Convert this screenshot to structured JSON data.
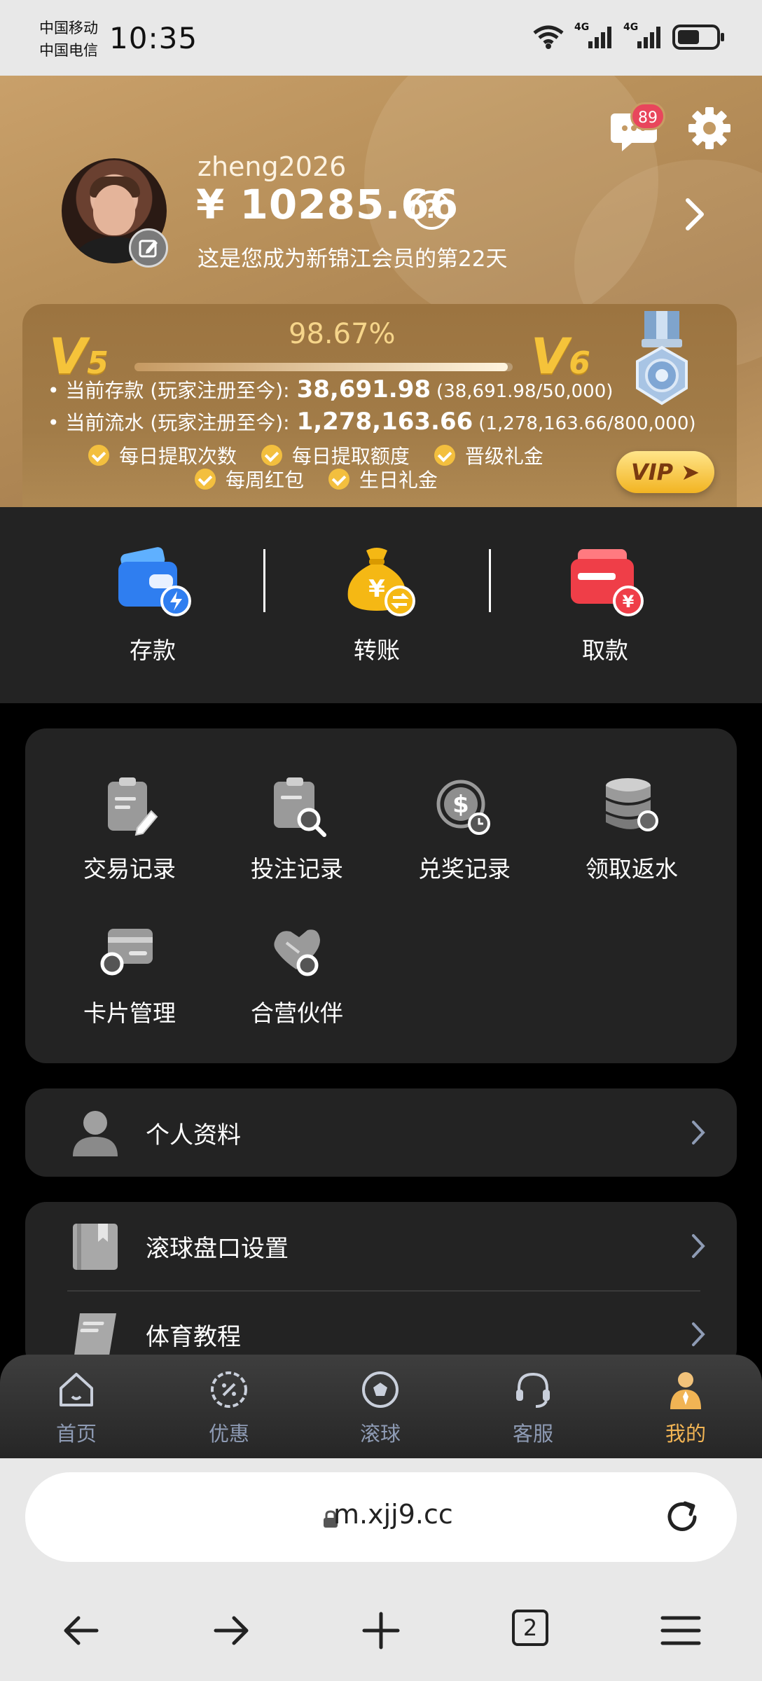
{
  "status_bar": {
    "carrier1": "中国移动",
    "carrier2": "中国电信",
    "time": "10:35",
    "net1": "4G",
    "net2": "4G"
  },
  "header": {
    "message_count": "89",
    "username": "zheng2026",
    "balance": "¥ 10285.66",
    "help": "?",
    "member_days": "这是您成为新锦江会员的第22天"
  },
  "vip": {
    "percent": "98.67%",
    "progress": 0.9867,
    "current_level": "V",
    "current_level_num": "5",
    "next_level": "V",
    "next_level_num": "6",
    "deposit_label": "• 当前存款 (玩家注册至今):",
    "deposit_value": "38,691.98",
    "deposit_paren": "(38,691.98/50,000)",
    "turnover_label": "• 当前流水 (玩家注册至今):",
    "turnover_value": "1,278,163.66",
    "turnover_paren": "(1,278,163.66/800,000)",
    "perks_row1": [
      "每日提取次数",
      "每日提取额度",
      "晋级礼金"
    ],
    "perks_row2": [
      "每周红包",
      "生日礼金"
    ],
    "vip_button": "VIP ➤"
  },
  "actions": [
    {
      "label": "存款",
      "icon": "wallet-icon"
    },
    {
      "label": "转账",
      "icon": "money-bag-icon"
    },
    {
      "label": "取款",
      "icon": "card-withdraw-icon"
    }
  ],
  "grid": [
    {
      "label": "交易记录",
      "icon": "clipboard-pen-icon"
    },
    {
      "label": "投注记录",
      "icon": "clipboard-search-icon"
    },
    {
      "label": "兑奖记录",
      "icon": "dollar-clock-icon"
    },
    {
      "label": "领取返水",
      "icon": "coin-stack-icon"
    },
    {
      "label": "卡片管理",
      "icon": "card-icon"
    },
    {
      "label": "合营伙伴",
      "icon": "handshake-icon"
    }
  ],
  "list1": [
    {
      "label": "个人资料",
      "icon": "person-icon"
    }
  ],
  "list2": [
    {
      "label": "滚球盘口设置",
      "icon": "bookmark-book-icon"
    },
    {
      "label": "体育教程",
      "icon": "book-icon"
    }
  ],
  "tabs": [
    {
      "label": "首页",
      "icon": "home-icon"
    },
    {
      "label": "优惠",
      "icon": "discount-gear-icon"
    },
    {
      "label": "滚球",
      "icon": "ball-icon"
    },
    {
      "label": "客服",
      "icon": "headset-icon"
    },
    {
      "label": "我的",
      "icon": "user-icon"
    }
  ],
  "browser": {
    "url": "m.xjj9.cc",
    "tab_count": "2"
  },
  "colors": {
    "gold_accent": "#f1b454",
    "badge_red": "#e8465c",
    "card_bg": "#232323",
    "tab_inactive": "#8e9bb4"
  }
}
